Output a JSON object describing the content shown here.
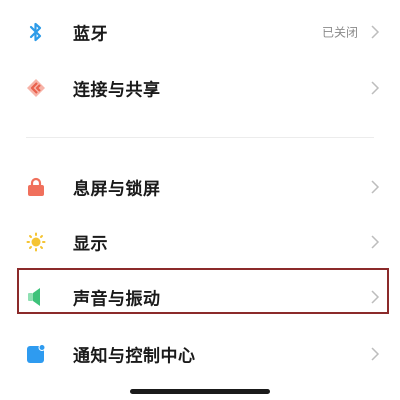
{
  "settings": {
    "bluetooth": {
      "label": "蓝牙",
      "status": "已关闭",
      "icon": "bluetooth-icon",
      "color": "#2d9be8"
    },
    "connection_sharing": {
      "label": "连接与共享",
      "icon": "connection-sharing-icon",
      "color": "#e8604c"
    },
    "lock_screen": {
      "label": "息屏与锁屏",
      "icon": "lock-icon",
      "color": "#f0705c"
    },
    "display": {
      "label": "显示",
      "icon": "sun-icon",
      "color": "#f5c433"
    },
    "sound_vibration": {
      "label": "声音与振动",
      "icon": "speaker-icon",
      "color": "#3ec27a",
      "highlighted": true
    },
    "notification_control": {
      "label": "通知与控制中心",
      "icon": "notification-icon",
      "color": "#2e9bf0"
    }
  },
  "colors": {
    "highlight_border": "#8b2a2a",
    "chevron": "#bdbdbd",
    "divider": "#ececec"
  }
}
